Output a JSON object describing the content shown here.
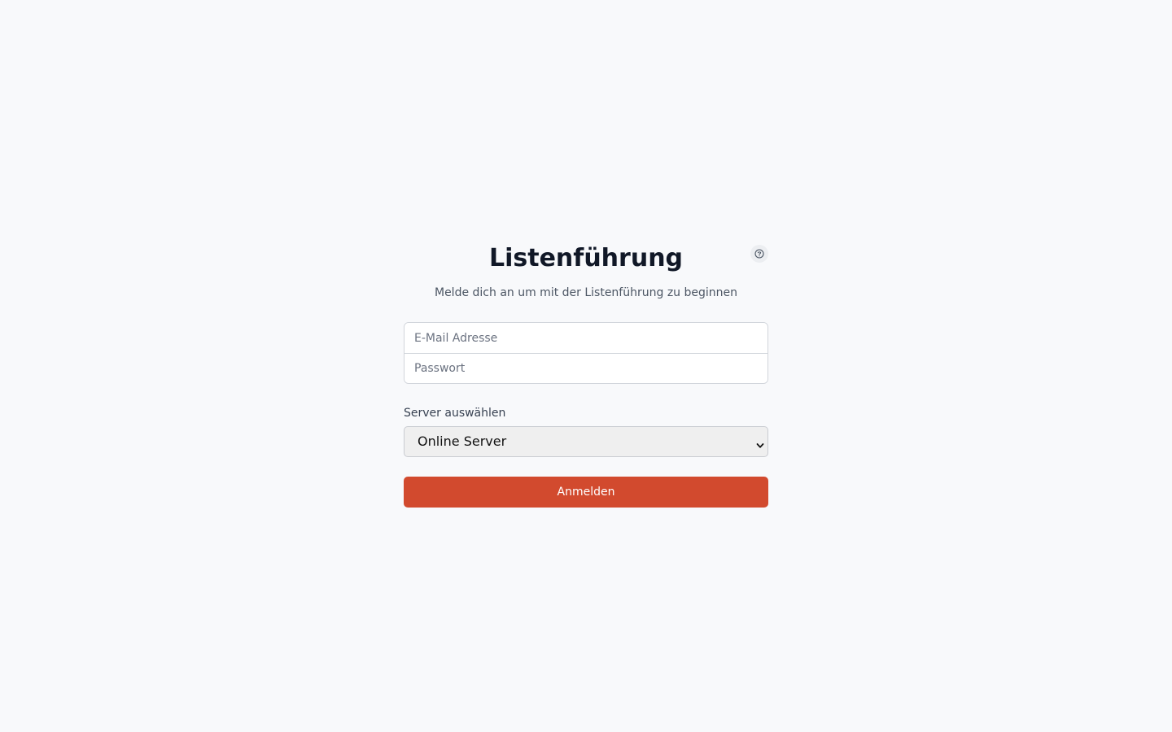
{
  "header": {
    "title": "Listenführung",
    "subtitle": "Melde dich an um mit der Listenführung zu beginnen",
    "help_icon": "question-circle-icon"
  },
  "form": {
    "email_placeholder": "E-Mail Adresse",
    "email_value": "",
    "password_placeholder": "Passwort",
    "password_value": "",
    "server_label": "Server auswählen",
    "server_selected": "Online Server",
    "submit_label": "Anmelden"
  },
  "colors": {
    "background": "#f8f9fb",
    "accent": "#d24a2e",
    "title": "#111827"
  }
}
